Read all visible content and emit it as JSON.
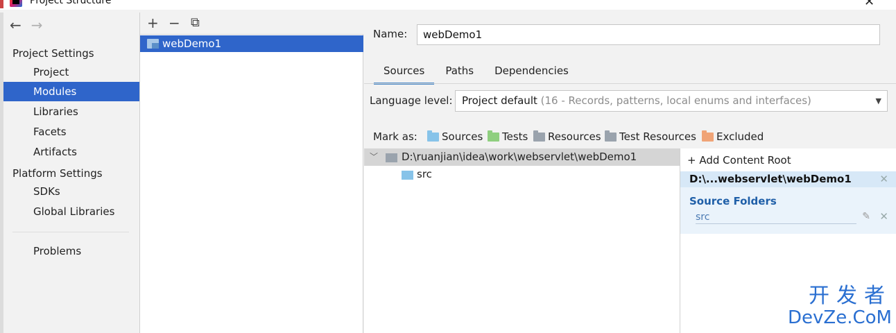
{
  "window": {
    "title": "Project Structure",
    "close_glyph": "✕"
  },
  "nav": {
    "back_glyph": "←",
    "forward_glyph": "→",
    "project_settings_header": "Project Settings",
    "project_settings_items": [
      "Project",
      "Modules",
      "Libraries",
      "Facets",
      "Artifacts"
    ],
    "platform_settings_header": "Platform Settings",
    "platform_settings_items": [
      "SDKs",
      "Global Libraries"
    ],
    "problems": "Problems",
    "selected": "Modules"
  },
  "modules": {
    "toolbar": {
      "add": "+",
      "remove": "−",
      "copy": "⧉"
    },
    "items": [
      "webDemo1"
    ],
    "selected": "webDemo1"
  },
  "detail": {
    "name_label": "Name:",
    "name_value": "webDemo1",
    "tabs": [
      "Sources",
      "Paths",
      "Dependencies"
    ],
    "active_tab": "Sources",
    "language_level_label": "Language level:",
    "language_level_value": "Project default",
    "language_level_detail": "(16 - Records, patterns, local enums and interfaces)",
    "mark_as_label": "Mark as:",
    "mark_as": [
      {
        "label": "Sources",
        "color": "#87c3e9"
      },
      {
        "label": "Tests",
        "color": "#8fcf7f"
      },
      {
        "label": "Resources",
        "color": "#9aa3ad"
      },
      {
        "label": "Test Resources",
        "color": "#9aa3ad"
      },
      {
        "label": "Excluded",
        "color": "#f0a477"
      }
    ],
    "tree": {
      "root_path": "D:\\ruanjian\\idea\\work\\webservlet\\webDemo1",
      "child": "src"
    },
    "content_roots": {
      "add_label": "Add Content Root",
      "add_glyph": "+",
      "root_short": "D:\\...webservlet\\webDemo1",
      "source_folders_title": "Source Folders",
      "source_entry": "src",
      "edit_glyph": "✎",
      "remove_glyph": "✕"
    }
  },
  "watermark": {
    "cn": "开发者",
    "en": "DevZe.CoM"
  },
  "colors": {
    "selection": "#2f65ca",
    "tab_underline": "#4a88c7",
    "source_folders_title": "#1f5fa8",
    "watermark": "#2a6fd1"
  }
}
